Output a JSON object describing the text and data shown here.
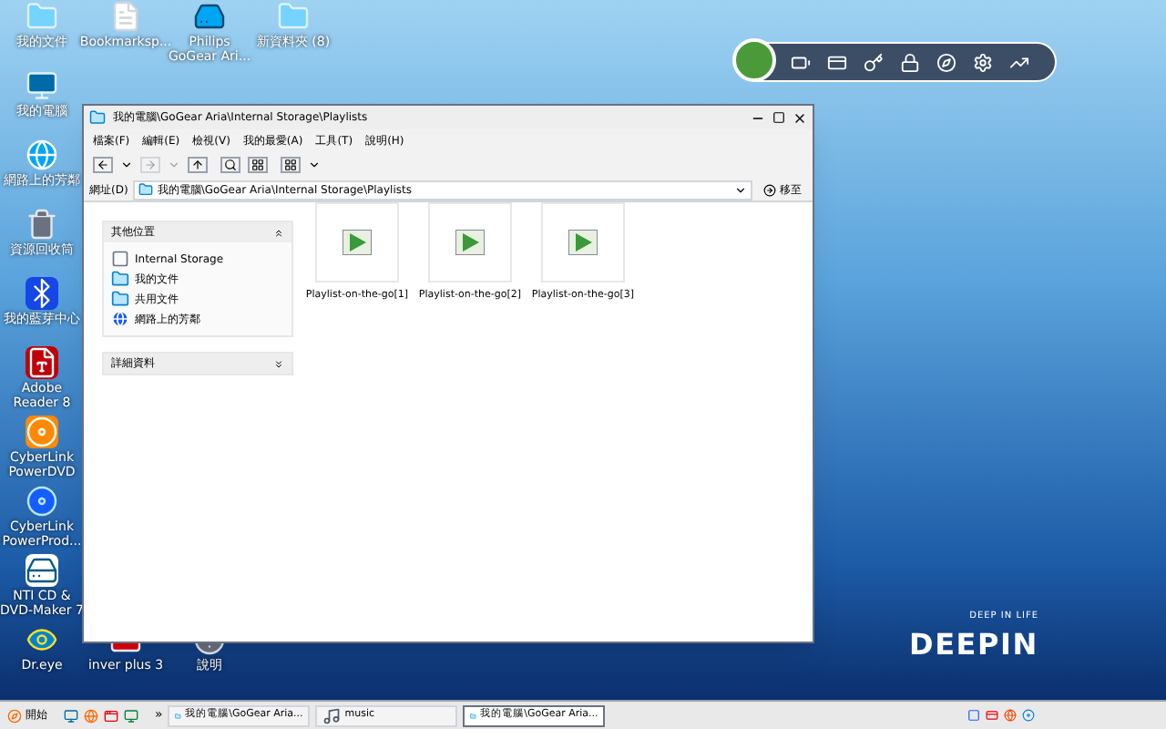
{
  "desktop": {
    "top_row": [
      {
        "label": "我的文件",
        "kind": "folder"
      },
      {
        "label": "Bookmarksp...",
        "kind": "file"
      },
      {
        "label": "Philips GoGear Ari...",
        "kind": "device"
      },
      {
        "label": "新資料夾 (8)",
        "kind": "folder"
      }
    ],
    "left_column": [
      {
        "label": "我的電腦",
        "kind": "computer"
      },
      {
        "label": "網路上的芳鄰",
        "kind": "globe"
      },
      {
        "label": "資源回收筒",
        "kind": "trash"
      },
      {
        "label": "我的藍芽中心",
        "kind": "bluetooth"
      },
      {
        "label": "Adobe Reader 8",
        "kind": "pdf"
      },
      {
        "label": "CyberLink PowerDVD",
        "kind": "dvd"
      },
      {
        "label": "CyberLink PowerProd...",
        "kind": "disc"
      },
      {
        "label": "NTI CD & DVD-Maker 7",
        "kind": "nti"
      },
      {
        "label": "Dr.eye",
        "kind": "eye"
      }
    ],
    "bottom_row": [
      {
        "label": "inver plus 3",
        "kind": "app"
      },
      {
        "label": "說明",
        "kind": "help"
      }
    ],
    "wallpaper_logo": {
      "tagline": "DEEP IN LIFE",
      "name": "DEEPIN"
    }
  },
  "window": {
    "title": "我的電腦\\GoGear Aria\\Internal Storage\\Playlists",
    "menu": [
      "檔案(F)",
      "編輯(E)",
      "檢視(V)",
      "我的最愛(A)",
      "工具(T)",
      "說明(H)"
    ],
    "address": {
      "label": "網址(D)",
      "value": "我的電腦\\GoGear Aria\\Internal Storage\\Playlists",
      "go": "移至"
    },
    "panels": [
      {
        "title": "其他位置",
        "expanded": true,
        "items": [
          {
            "label": "Internal Storage",
            "kind": "drive"
          },
          {
            "label": "我的文件",
            "kind": "folder"
          },
          {
            "label": "共用文件",
            "kind": "folder"
          },
          {
            "label": "網路上的芳鄰",
            "kind": "globe"
          }
        ]
      },
      {
        "title": "詳細資料",
        "expanded": false
      }
    ],
    "files": [
      {
        "name": "Playlist-on-the-go[1]",
        "selected": false
      },
      {
        "name": "Playlist-on-the-go[2]",
        "selected": false
      },
      {
        "name": "Playlist-on-the-go[3]",
        "selected": false
      }
    ]
  },
  "taskbar": {
    "start": "開始",
    "overflow": "»",
    "tasks": [
      {
        "label": "我的電腦\\GoGear Aria...",
        "kind": "folder",
        "selected": false
      },
      {
        "label": "music",
        "kind": "music",
        "selected": false
      },
      {
        "label": "我的電腦\\GoGear Aria...",
        "kind": "folder",
        "selected": true
      }
    ]
  }
}
